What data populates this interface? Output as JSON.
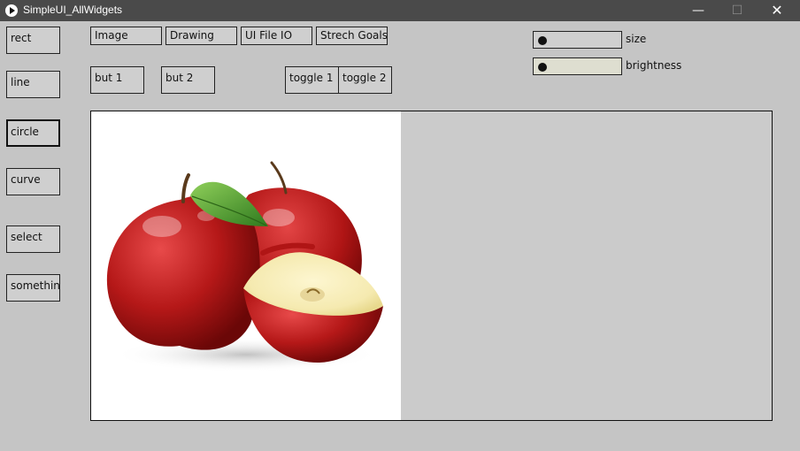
{
  "window": {
    "title": "SimpleUI_AllWidgets",
    "minimize_glyph": "—",
    "maximize_glyph": "☐",
    "close_glyph": "✕"
  },
  "tools": [
    {
      "label": "rect",
      "selected": false
    },
    {
      "label": "line",
      "selected": false
    },
    {
      "label": "circle",
      "selected": true
    },
    {
      "label": "curve",
      "selected": false
    },
    {
      "label": "select",
      "selected": false
    },
    {
      "label": "somethin",
      "selected": false
    }
  ],
  "menu": [
    "Image",
    "Drawing",
    "UI File IO",
    "Strech Goals"
  ],
  "buttons": [
    "but 1",
    "but 2"
  ],
  "toggles": [
    "toggle 1",
    "toggle 2"
  ],
  "sliders": [
    {
      "label": "size",
      "value": 0,
      "fill": "#cfcfcf"
    },
    {
      "label": "brightness",
      "value": 0,
      "fill": "#deded0"
    }
  ],
  "canvas": {
    "image_subject": "red-apples-photo",
    "background": "#cbcbcb"
  }
}
